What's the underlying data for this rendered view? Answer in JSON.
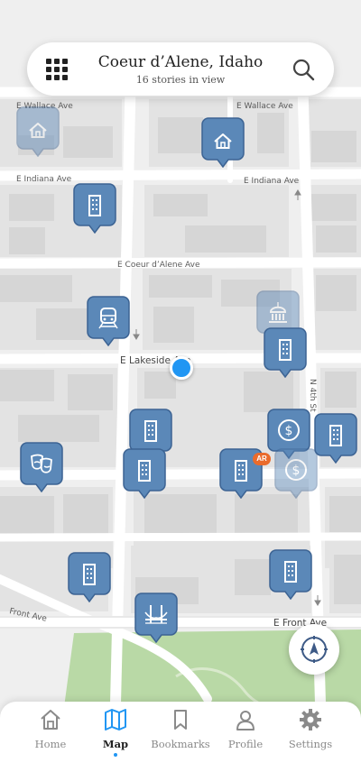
{
  "header": {
    "title": "Coeur d’Alene, Idaho",
    "subtitle": "16 stories in view"
  },
  "streets": {
    "wallace_left": "E Wallace Ave",
    "wallace_right": "E Wallace Ave",
    "indiana_left": "E Indiana Ave",
    "indiana_right": "E Indiana Ave",
    "coeur": "E Coeur d’Alene Ave",
    "lakeside": "E Lakeside Ave",
    "n4th": "N 4th St",
    "front_left": "Front Ave",
    "front_right": "E Front Ave"
  },
  "markers": [
    {
      "icon": "house-icon",
      "faded": true
    },
    {
      "icon": "house-icon",
      "faded": false
    },
    {
      "icon": "building-icon",
      "faded": false
    },
    {
      "icon": "train-icon",
      "faded": false
    },
    {
      "icon": "capitol-icon",
      "faded": true
    },
    {
      "icon": "building-icon",
      "faded": false
    },
    {
      "icon": "building-icon",
      "faded": false
    },
    {
      "icon": "dollar-icon",
      "faded": false
    },
    {
      "icon": "building-icon",
      "faded": false
    },
    {
      "icon": "theater-masks-icon",
      "faded": false
    },
    {
      "icon": "building-icon",
      "faded": false
    },
    {
      "icon": "building-icon",
      "faded": false
    },
    {
      "icon": "dollar-icon",
      "faded": true
    },
    {
      "icon": "building-icon",
      "faded": false
    },
    {
      "icon": "building-icon",
      "faded": false
    },
    {
      "icon": "bridge-icon",
      "faded": false
    }
  ],
  "ar_badge": "AR",
  "colors": {
    "marker": "#5b88b8",
    "accent": "#2196f3",
    "ar_badge": "#ea6b2c",
    "park": "#b9d9a6"
  },
  "tabs": [
    {
      "label": "Home",
      "icon": "home-icon",
      "active": false
    },
    {
      "label": "Map",
      "icon": "map-icon",
      "active": true
    },
    {
      "label": "Bookmarks",
      "icon": "bookmark-icon",
      "active": false
    },
    {
      "label": "Profile",
      "icon": "profile-icon",
      "active": false
    },
    {
      "label": "Settings",
      "icon": "gear-icon",
      "active": false
    }
  ]
}
